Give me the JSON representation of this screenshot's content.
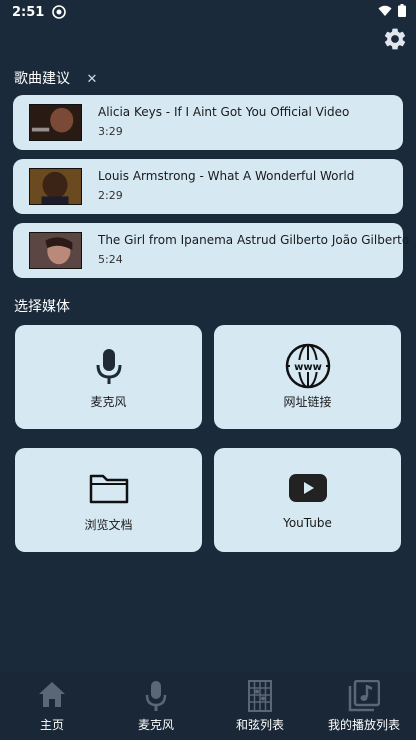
{
  "status_bar": {
    "time": "2:51"
  },
  "suggestions": {
    "title": "歌曲建议",
    "close_label": "✕",
    "songs": [
      {
        "title": "Alicia Keys - If I Aint Got You Official Video",
        "duration": "3:29"
      },
      {
        "title": "Louis Armstrong - What A Wonderful World",
        "duration": "2:29"
      },
      {
        "title": "The Girl from Ipanema  Astrud Gilberto João Gilberto",
        "duration": "5:24"
      }
    ]
  },
  "media": {
    "title": "选择媒体",
    "options": [
      {
        "label": "麦克风",
        "icon": "microphone-icon"
      },
      {
        "label": "网址链接",
        "icon": "globe-www-icon"
      },
      {
        "label": "浏览文档",
        "icon": "folder-icon"
      },
      {
        "label": "YouTube",
        "icon": "youtube-icon"
      }
    ]
  },
  "bottom_nav": {
    "items": [
      {
        "label": "主页",
        "icon": "home-icon"
      },
      {
        "label": "麦克风",
        "icon": "microphone-icon"
      },
      {
        "label": "和弦列表",
        "icon": "chord-grid-icon"
      },
      {
        "label": "我的播放列表",
        "icon": "playlist-icon"
      }
    ]
  },
  "colors": {
    "background": "#1b2a3b",
    "card": "#d6e9f3",
    "nav_bar": "#1a2736"
  }
}
